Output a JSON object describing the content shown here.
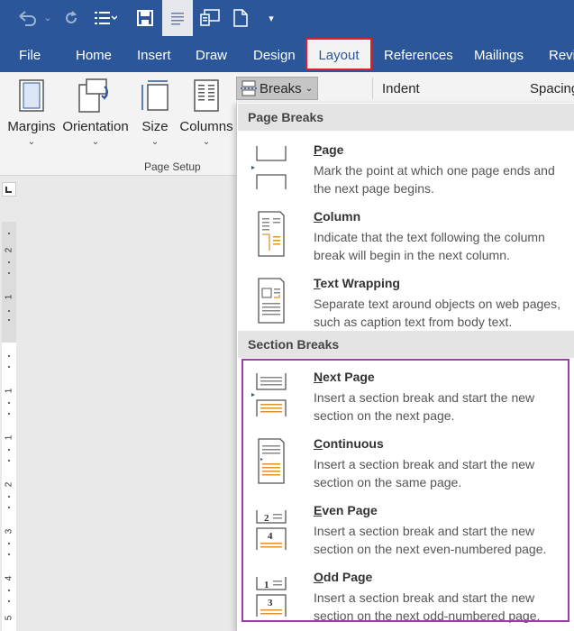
{
  "colors": {
    "ribbon_blue": "#2b579a",
    "selected_outline": "#e01e2a",
    "section_outline": "#9b3fa6",
    "icon_orange": "#e0922f"
  },
  "qat": {
    "icons": [
      "undo-icon",
      "redo-icon",
      "refresh-icon",
      "list-icon",
      "save-icon",
      "view-icon",
      "screen-icon",
      "new-document-icon",
      "customize-icon"
    ]
  },
  "tabs": [
    {
      "label": "File"
    },
    {
      "label": "Home"
    },
    {
      "label": "Insert"
    },
    {
      "label": "Draw"
    },
    {
      "label": "Design"
    },
    {
      "label": "Layout"
    },
    {
      "label": "References"
    },
    {
      "label": "Mailings"
    },
    {
      "label": "Revi"
    }
  ],
  "ribbon": {
    "margins": "Margins",
    "orientation": "Orientation",
    "size": "Size",
    "columns": "Columns",
    "group_label": "Page Setup",
    "breaks": "Breaks",
    "indent": "Indent",
    "spacing": "Spacing"
  },
  "ruler": {
    "numbers": [
      "2",
      "1",
      "1",
      "1",
      "2",
      "3",
      "4",
      "5"
    ]
  },
  "menu": {
    "page_breaks_header": "Page Breaks",
    "section_breaks_header": "Section Breaks",
    "items": [
      {
        "title_u": "P",
        "title_rest": "age",
        "desc": "Mark the point at which one page ends and the next page begins."
      },
      {
        "title_u": "C",
        "title_rest": "olumn",
        "desc": "Indicate that the text following the column break will begin in the next column."
      },
      {
        "title_u": "T",
        "title_rest": "ext Wrapping",
        "desc": "Separate text around objects on web pages, such as caption text from body text."
      },
      {
        "title_u": "N",
        "title_rest": "ext Page",
        "desc": "Insert a section break and start the new section on the next page."
      },
      {
        "title_u": "C",
        "title_rest": "ontinuous",
        "desc": "Insert a section break and start the new section on the same page."
      },
      {
        "title_u": "E",
        "title_rest": "ven Page",
        "desc": "Insert a section break and start the new section on the next even-numbered page.",
        "badge": [
          "2",
          "4"
        ]
      },
      {
        "title_u": "O",
        "title_rest": "dd Page",
        "desc": "Insert a section break and start the new section on the next odd-numbered page.",
        "badge": [
          "1",
          "3"
        ]
      }
    ]
  }
}
